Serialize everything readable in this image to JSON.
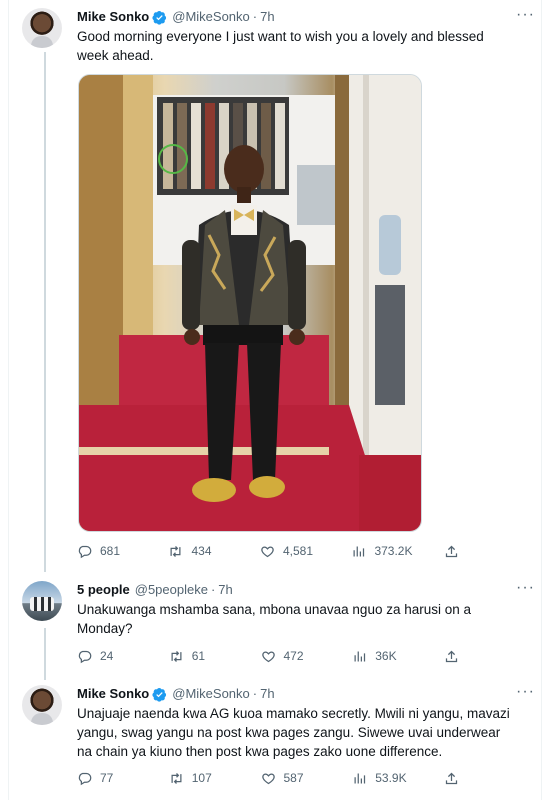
{
  "tweets": [
    {
      "name": "Mike Sonko",
      "handle": "@MikeSonko",
      "time": "7h",
      "text": "Good morning everyone I just want to wish you a lovely and blessed week ahead.",
      "media_icon": "photo-image",
      "replies": "681",
      "retweets": "434",
      "likes": "4,581",
      "views": "373.2K"
    },
    {
      "name": "5 people",
      "handle": "@5peopleke",
      "time": "7h",
      "text": "Unakuwanga mshamba sana, mbona unavaa nguo za harusi on a Monday?",
      "replies": "24",
      "retweets": "61",
      "likes": "472",
      "views": "36K"
    },
    {
      "name": "Mike Sonko",
      "handle": "@MikeSonko",
      "time": "7h",
      "text": "Unajuaje naenda kwa AG kuoa mamako secretly. Mwili ni yangu, mavazi yangu,  swag yangu na post kwa pages zangu. Siwewe uvai underwear na chain ya kiuno then post kwa pages zako uone difference.",
      "replies": "77",
      "retweets": "107",
      "likes": "587",
      "views": "53.9K"
    }
  ],
  "icons": {
    "verified": "verified-badge-icon",
    "reply": "reply-icon",
    "retweet": "retweet-icon",
    "like": "heart-icon",
    "views": "views-icon",
    "share": "share-icon",
    "more": "more-icon"
  },
  "colors": {
    "verified": "#1d9bf0",
    "icon_gray": "#536471",
    "thread_line": "#cfd9de"
  }
}
